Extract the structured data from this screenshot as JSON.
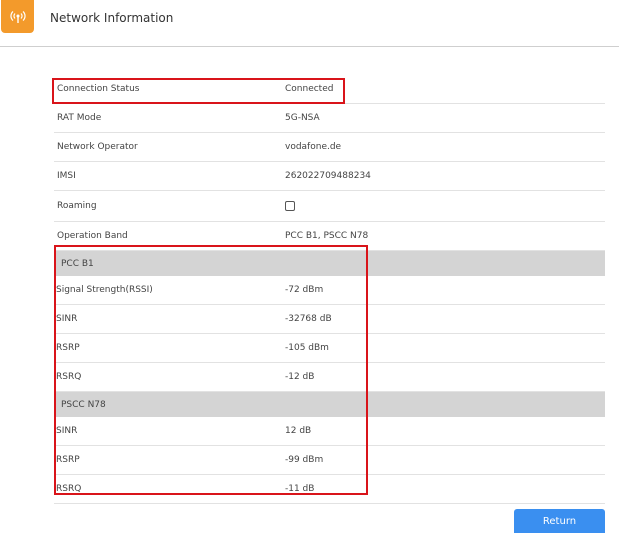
{
  "header": {
    "title": "Network Information",
    "logo_icon": "antenna-signal-icon",
    "logo_color": "#f39a2b"
  },
  "info_rows": [
    {
      "label": "Connection Status",
      "value": "Connected"
    },
    {
      "label": "RAT Mode",
      "value": "5G-NSA"
    },
    {
      "label": "Network Operator",
      "value": "vodafone.de"
    },
    {
      "label": "IMSI",
      "value": "262022709488234"
    },
    {
      "label": "Roaming",
      "value": "",
      "checked": false
    },
    {
      "label": "Operation Band",
      "value": "PCC B1, PSCC N78"
    }
  ],
  "pcc": {
    "title": "PCC B1",
    "rows": [
      {
        "label": "Signal Strength(RSSI)",
        "value": "-72 dBm"
      },
      {
        "label": "SINR",
        "value": "-32768 dB"
      },
      {
        "label": "RSRP",
        "value": "-105 dBm"
      },
      {
        "label": "RSRQ",
        "value": "-12 dB"
      }
    ]
  },
  "pscc": {
    "title": "PSCC N78",
    "rows": [
      {
        "label": "SINR",
        "value": "12 dB"
      },
      {
        "label": "RSRP",
        "value": "-99 dBm"
      },
      {
        "label": "RSRQ",
        "value": "-11 dB"
      }
    ]
  },
  "actions": {
    "return_label": "Return"
  },
  "colors": {
    "accent": "#3a8ff0",
    "highlight": "#d9141a",
    "group_bg": "#d4d4d4"
  }
}
